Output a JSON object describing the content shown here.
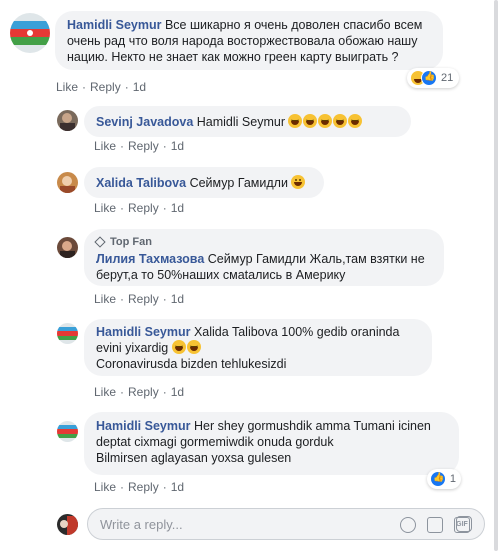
{
  "comments": [
    {
      "author": "Hamidli Seymur",
      "text": "Все шикарно я очень доволен спасибо всем очень рад что воля народа восторжествовала обожаю нашу нацию. Некто не знает как можно греен карту выиграть ?",
      "like": "Like",
      "reply": "Reply",
      "time": "1d",
      "reaction_count": "21"
    },
    {
      "author": "Sevinj Javadova",
      "text": "Hamidli Seymur",
      "like": "Like",
      "reply": "Reply",
      "time": "1d"
    },
    {
      "author": "Xalida Talibova",
      "text": "Сеймур Гамидли",
      "like": "Like",
      "reply": "Reply",
      "time": "1d"
    },
    {
      "badge": "Top Fan",
      "author": "Лилия Тахмазова",
      "text": "Сеймур Гамидли Жаль,там взятки не берут,а то 50%наших смatались в Америку",
      "like": "Like",
      "reply": "Reply",
      "time": "1d"
    },
    {
      "author": "Hamidli Seymur",
      "text_line1": "Xalida Talibova 100% gedib oraninda evini yixardig",
      "text_line2": "Coronavirusda bizden tehlukesizdi",
      "like": "Like",
      "reply": "Reply",
      "time": "1d"
    },
    {
      "author": "Hamidli Seymur",
      "text_line1": "Her shey gormushdik amma Tumani icinen deptat cixmagi gormemiwdik onuda gorduk",
      "text_line2": "Bilmirsen aglayasan yoxsa gulesen",
      "like": "Like",
      "reply": "Reply",
      "time": "1d",
      "reaction_count": "1"
    }
  ],
  "reply_box": {
    "placeholder": "Write a reply..."
  },
  "colors": {
    "link_blue": "#385898",
    "bubble_bg": "#f2f3f5",
    "meta_gray": "#606770"
  }
}
